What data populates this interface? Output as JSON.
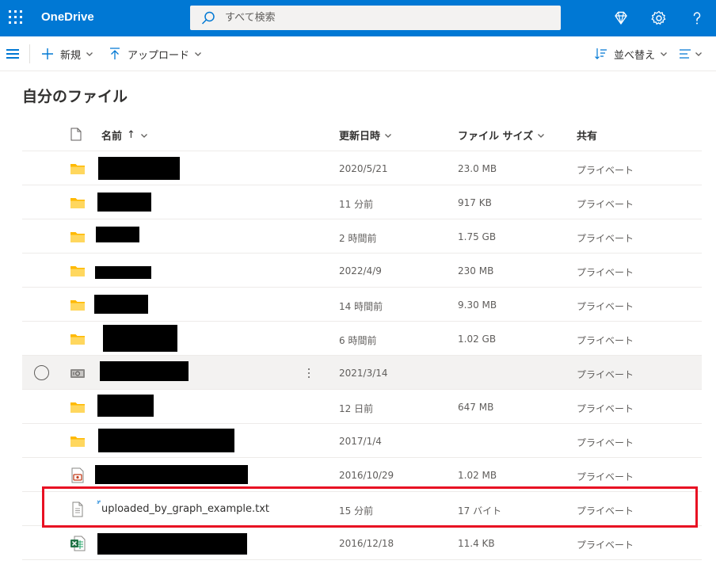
{
  "app": {
    "brand": "OneDrive"
  },
  "search": {
    "placeholder": "すべて検索"
  },
  "toolbar": {
    "new_label": "新規",
    "upload_label": "アップロード",
    "sort_label": "並べ替え"
  },
  "page": {
    "title": "自分のファイル"
  },
  "columns": {
    "name": "名前",
    "name_sort": "↑",
    "modified": "更新日時",
    "size": "ファイル サイズ",
    "sharing": "共有"
  },
  "rows": [
    {
      "type": "folder",
      "name": "",
      "modified": "2020/5/21",
      "size": "23.0 MB",
      "sharing": "プライベート"
    },
    {
      "type": "folder",
      "name": "",
      "modified": "11 分前",
      "size": "917 KB",
      "sharing": "プライベート"
    },
    {
      "type": "folder",
      "name": "",
      "modified": "2 時間前",
      "size": "1.75 GB",
      "sharing": "プライベート"
    },
    {
      "type": "folder",
      "name": "",
      "modified": "2022/4/9",
      "size": "230 MB",
      "sharing": "プライベート"
    },
    {
      "type": "folder",
      "name": "",
      "modified": "14 時間前",
      "size": "9.30 MB",
      "sharing": "プライベート"
    },
    {
      "type": "folder",
      "name": "",
      "modified": "6 時間前",
      "size": "1.02 GB",
      "sharing": "プライベート"
    },
    {
      "type": "vault",
      "name": "",
      "modified": "2021/3/14",
      "size": "",
      "sharing": "プライベート"
    },
    {
      "type": "folder",
      "name": "",
      "modified": "12 日前",
      "size": "647 MB",
      "sharing": "プライベート"
    },
    {
      "type": "folder",
      "name": "",
      "modified": "2017/1/4",
      "size": "",
      "sharing": "プライベート"
    },
    {
      "type": "video",
      "name": "",
      "modified": "2016/10/29",
      "size": "1.02 MB",
      "sharing": "プライベート"
    },
    {
      "type": "text",
      "name": "uploaded_by_graph_example.txt",
      "modified": "15 分前",
      "size": "17 バイト",
      "sharing": "プライベート"
    },
    {
      "type": "excel",
      "name": "",
      "modified": "2016/12/18",
      "size": "11.4 KB",
      "sharing": "プライベート"
    }
  ],
  "colors": {
    "brand_blue": "#0078d4",
    "folder_yellow": "#ffb900",
    "highlight_red": "#e81123",
    "excel_green": "#217346"
  }
}
